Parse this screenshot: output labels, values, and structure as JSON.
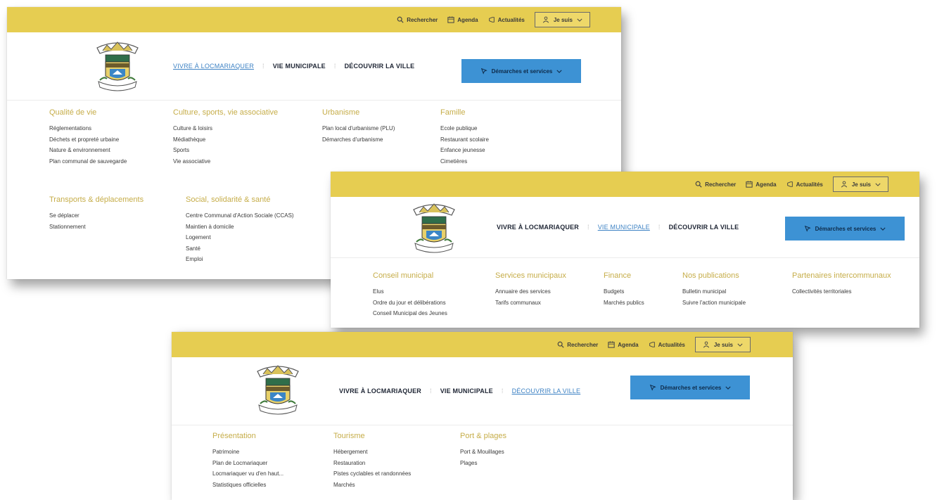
{
  "topbar": {
    "search_label": "Rechercher",
    "agenda_label": "Agenda",
    "news_label": "Actualités",
    "jesuis_label": "Je suis"
  },
  "main_nav": {
    "item1": "VIVRE À LOCMARIAQUER",
    "item2": "VIE MUNICIPALE",
    "item3": "DÉCOUVRIR LA VILLE",
    "separator": "⁞"
  },
  "cta_label": "Démarches et services",
  "colors": {
    "topbar": "#e6cd51",
    "accent_blue": "#3d92d4",
    "heading_gold": "#c6ad49"
  },
  "panel1": {
    "columns": [
      {
        "title": "Qualité de vie",
        "items": [
          "Réglementations",
          "Déchets et propreté urbaine",
          "Nature & environnement",
          "Plan communal de sauvegarde"
        ]
      },
      {
        "title": "Culture, sports, vie associative",
        "items": [
          "Culture & loisirs",
          "Médiathèque",
          "Sports",
          "Vie associative"
        ]
      },
      {
        "title": "Urbanisme",
        "items": [
          "Plan local d'urbanisme (PLU)",
          "Démarches d'urbanisme"
        ]
      },
      {
        "title": "Famille",
        "items": [
          "Ecole publique",
          "Restaurant scolaire",
          "Enfance jeunesse",
          "Cimetières"
        ]
      },
      {
        "title": "Transports & déplacements",
        "items": [
          "Se déplacer",
          "Stationnement"
        ]
      },
      {
        "title": "Social, solidarité & santé",
        "items": [
          "Centre Communal d'Action Sociale (CCAS)",
          "Maintien à domicile",
          "Logement",
          "Santé",
          "Emploi"
        ]
      }
    ]
  },
  "panel2": {
    "columns": [
      {
        "title": "Conseil municipal",
        "items": [
          "Elus",
          "Ordre du jour et délibérations",
          "Conseil Municipal des Jeunes"
        ]
      },
      {
        "title": "Services municipaux",
        "items": [
          "Annuaire des services",
          "Tarifs communaux"
        ]
      },
      {
        "title": "Finance",
        "items": [
          "Budgets",
          "Marchés publics"
        ]
      },
      {
        "title": "Nos publications",
        "items": [
          "Bulletin municipal",
          "Suivre l'action municipale"
        ]
      },
      {
        "title": "Partenaires intercommunaux",
        "items": [
          "Collectivités territoriales"
        ]
      }
    ]
  },
  "panel3": {
    "columns": [
      {
        "title": "Présentation",
        "items": [
          "Patrimoine",
          "Plan de Locmariaquer",
          "Locmariaquer vu d'en haut...",
          "Statistiques officielles"
        ]
      },
      {
        "title": "Tourisme",
        "items": [
          "Hébergement",
          "Restauration",
          "Pistes cyclables et randonnées",
          "Marchés"
        ]
      },
      {
        "title": "Port & plages",
        "items": [
          "Port & Mouillages",
          "Plages"
        ]
      }
    ]
  }
}
